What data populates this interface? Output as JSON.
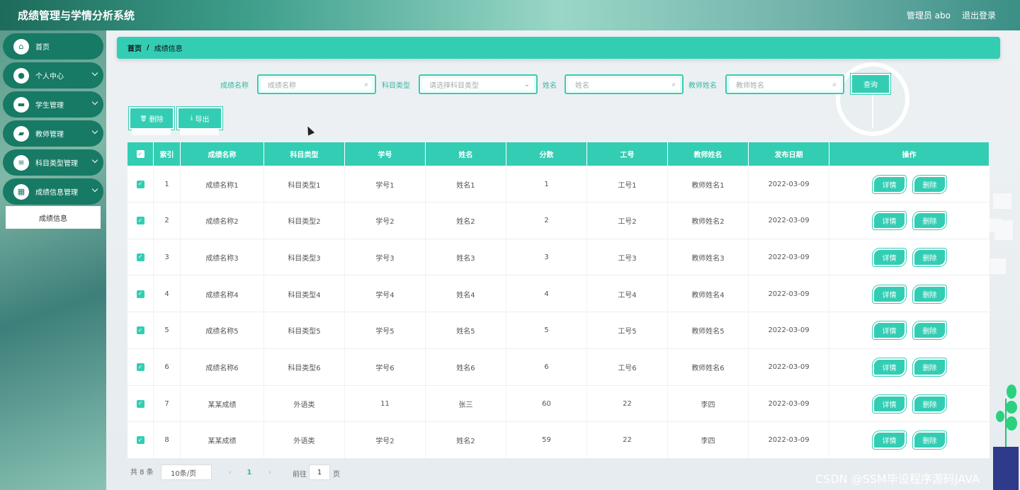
{
  "app": {
    "title": "成绩管理与学情分析系统",
    "user": "管理员 abo",
    "logout": "退出登录"
  },
  "sidebar": {
    "items": [
      {
        "label": "首页",
        "icon": "home-icon",
        "glyph": "⌂"
      },
      {
        "label": "个人中心",
        "icon": "user-icon",
        "glyph": "●"
      },
      {
        "label": "学生管理",
        "icon": "briefcase-icon",
        "glyph": "▬"
      },
      {
        "label": "教师管理",
        "icon": "wallet-icon",
        "glyph": "▰"
      },
      {
        "label": "科目类型管理",
        "icon": "list-icon",
        "glyph": "≡"
      },
      {
        "label": "成绩信息管理",
        "icon": "grid-icon",
        "glyph": "▦"
      }
    ],
    "submenu": "成绩信息"
  },
  "breadcrumb": {
    "home": "首页",
    "sep": "/",
    "current": "成绩信息"
  },
  "search": {
    "f1_label": "成绩名称",
    "f1_placeholder": "成绩名称",
    "f2_label": "科目类型",
    "f2_placeholder": "请选择科目类型",
    "f3_label": "姓名",
    "f3_placeholder": "姓名",
    "f4_label": "教师姓名",
    "f4_placeholder": "教师姓名",
    "query": "查询"
  },
  "actions": {
    "delete": "删除",
    "export": "导出",
    "delete_icon": "🗑",
    "export_icon": "⤓"
  },
  "table": {
    "headers": [
      "索引",
      "成绩名称",
      "科目类型",
      "学号",
      "姓名",
      "分数",
      "工号",
      "教师姓名",
      "发布日期",
      "操作"
    ],
    "detail_label": "详情",
    "delete_label": "删除",
    "rows": [
      [
        "1",
        "成绩名称1",
        "科目类型1",
        "学号1",
        "姓名1",
        "1",
        "工号1",
        "教师姓名1",
        "2022-03-09"
      ],
      [
        "2",
        "成绩名称2",
        "科目类型2",
        "学号2",
        "姓名2",
        "2",
        "工号2",
        "教师姓名2",
        "2022-03-09"
      ],
      [
        "3",
        "成绩名称3",
        "科目类型3",
        "学号3",
        "姓名3",
        "3",
        "工号3",
        "教师姓名3",
        "2022-03-09"
      ],
      [
        "4",
        "成绩名称4",
        "科目类型4",
        "学号4",
        "姓名4",
        "4",
        "工号4",
        "教师姓名4",
        "2022-03-09"
      ],
      [
        "5",
        "成绩名称5",
        "科目类型5",
        "学号5",
        "姓名5",
        "5",
        "工号5",
        "教师姓名5",
        "2022-03-09"
      ],
      [
        "6",
        "成绩名称6",
        "科目类型6",
        "学号6",
        "姓名6",
        "6",
        "工号6",
        "教师姓名6",
        "2022-03-09"
      ],
      [
        "7",
        "某某成绩",
        "外语类",
        "11",
        "张三",
        "60",
        "22",
        "李四",
        "2022-03-09"
      ],
      [
        "8",
        "某某成绩",
        "外语类",
        "学号2",
        "姓名2",
        "59",
        "22",
        "李四",
        "2022-03-09"
      ]
    ]
  },
  "pagination": {
    "total": "共 8 条",
    "page_size": "10条/页",
    "current": "1",
    "goto": "前往",
    "goto_value": "1",
    "unit": "页"
  },
  "watermark": "CSDN @SSM毕设程序源码JAVA",
  "colors": {
    "accent": "#33cdb4",
    "sidebar_item": "#177a64"
  }
}
